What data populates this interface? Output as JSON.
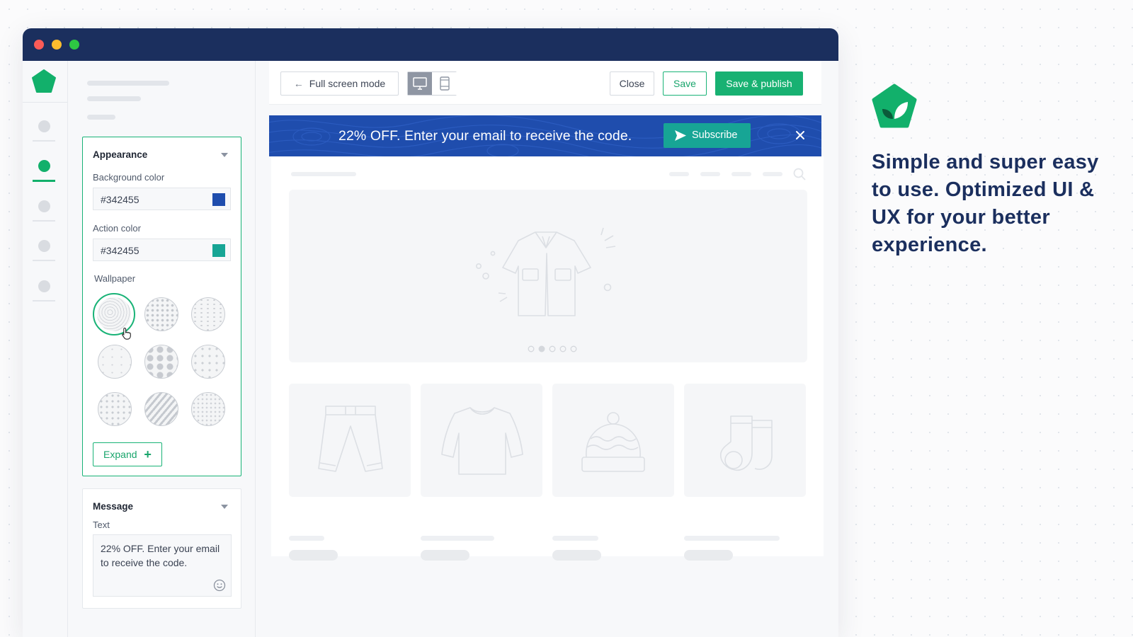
{
  "colors": {
    "titlebar": "#1b2f5e",
    "accent_green": "#18b172",
    "banner_bg": "#1f4dad",
    "subscribe_bg": "#17a595",
    "background_swatch": "#1f4dad",
    "action_swatch": "#17a595"
  },
  "panel": {
    "appearance": {
      "title": "Appearance",
      "background_color_label": "Background color",
      "background_color_value": "#342455",
      "action_color_label": "Action color",
      "action_color_value": "#342455",
      "wallpaper_label": "Wallpaper",
      "wallpaper_count": 9,
      "selected_wallpaper_index": 0,
      "expand_label": "Expand"
    },
    "message": {
      "title": "Message",
      "text_label": "Text",
      "text_value": "22% OFF. Enter your email to receive the code."
    }
  },
  "toolbar": {
    "fullscreen_label": "Full screen mode",
    "close_label": "Close",
    "save_label": "Save",
    "save_publish_label": "Save & publish",
    "active_device": "desktop"
  },
  "banner": {
    "text": "22% OFF. Enter your email to receive the code.",
    "subscribe_label": "Subscribe"
  },
  "promo": {
    "headline": "Simple and super easy to use. Optimized UI & UX for your better experience."
  },
  "preview": {
    "carousel_dots": 5,
    "active_dot": 1,
    "products": [
      "pants-icon",
      "sweater-icon",
      "beanie-icon",
      "socks-icon"
    ]
  }
}
